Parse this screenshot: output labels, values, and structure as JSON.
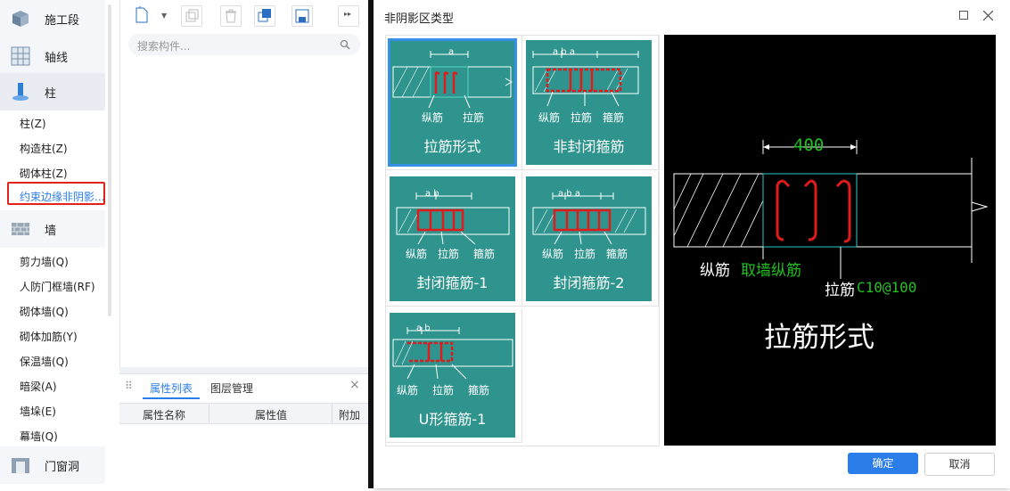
{
  "nav": {
    "categories": [
      {
        "label": "施工段",
        "icon": "cube-icon"
      },
      {
        "label": "轴线",
        "icon": "grid-icon"
      },
      {
        "label": "柱",
        "icon": "column-icon"
      },
      {
        "label": "墙",
        "icon": "wall-icon"
      },
      {
        "label": "门窗洞",
        "icon": "door-window-icon"
      }
    ],
    "column_items": [
      "柱(Z)",
      "构造柱(Z)",
      "砌体柱(Z)",
      "约束边缘非阴影..."
    ],
    "wall_items": [
      "剪力墙(Q)",
      "人防门框墙(RF)",
      "砌体墙(Q)",
      "砌体加筋(Y)",
      "保温墙(Q)",
      "暗梁(A)",
      "墙垛(E)",
      "幕墙(Q)"
    ]
  },
  "mid": {
    "search_placeholder": "搜索构件...",
    "tabs": [
      "属性列表",
      "图层管理"
    ],
    "columns": [
      "属性名称",
      "属性值",
      "附加"
    ]
  },
  "dialog": {
    "title": "非阴影区类型",
    "tiles": [
      {
        "caption": "拉筋形式",
        "dims": "a",
        "labels": [
          "纵筋",
          "拉筋"
        ],
        "selected": true
      },
      {
        "caption": "非封闭箍筋",
        "dims": "a b a",
        "labels": [
          "纵筋",
          "拉筋",
          "箍筋"
        ],
        "selected": false
      },
      {
        "caption": "封闭箍筋-1",
        "dims": "a b",
        "labels": [
          "纵筋",
          "拉筋",
          "箍筋"
        ],
        "selected": false
      },
      {
        "caption": "封闭箍筋-2",
        "dims": "a b a",
        "labels": [
          "纵筋",
          "拉筋",
          "箍筋"
        ],
        "selected": false
      },
      {
        "caption": "U形箍筋-1",
        "dims": "a b",
        "labels": [
          "纵筋",
          "拉筋",
          "箍筋"
        ],
        "selected": false
      }
    ],
    "preview": {
      "dimension": "400",
      "label_longbar": "纵筋",
      "label_wallbar": "取墙纵筋",
      "label_tie": "拉筋",
      "label_tie_spec": "C10@100",
      "caption": "拉筋形式"
    },
    "ok_label": "确定",
    "cancel_label": "取消",
    "colors": {
      "teal": "#2e948d",
      "accent": "#2b7de9",
      "green": "#22c022",
      "red": "#e01b1b"
    }
  }
}
